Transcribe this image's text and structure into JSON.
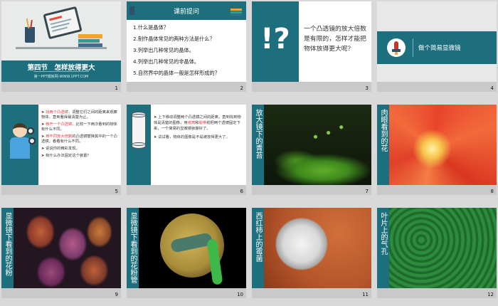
{
  "slides": [
    {
      "num": "1",
      "title": "第四节　怎样放得更大",
      "footer_text": "第一PPT模板网-WWW.1PPT.COM"
    },
    {
      "num": "2",
      "title": "课前提问",
      "items": [
        "1.什么是晶体？",
        "2.制作晶体常见的两种方法是什么？",
        "3.列举出几种常见的晶体。",
        "4.列举出几种常见的非晶体。",
        "5.自然界中的晶体一般是怎样形成的？"
      ]
    },
    {
      "num": "3",
      "symbol": "!?",
      "question": "一个凸透镜的放大倍数是有限的，怎样才能把物体放得更大呢？"
    },
    {
      "num": "4",
      "title": "做个简易显微镜"
    },
    {
      "num": "5",
      "bullets": [
        {
          "highlight": "找两个凸透镜，",
          "text": "调整它们之间的距离来观察物体，直到看得最清楚为止。"
        },
        {
          "highlight": "移开一个凸透镜，",
          "text": "比较一下两次看到的物体有什么不同。"
        },
        {
          "highlight": "用不同放大倍数",
          "text": "的凸透镜替换其中的一个凸透镜，看看有什么不同。"
        },
        {
          "highlight": "",
          "text": "说说你的精彩发现。"
        },
        {
          "highlight": "",
          "text": "有什么办法固定这个装置？"
        }
      ]
    },
    {
      "num": "6",
      "para1": [
        "上下移动调整两个凸透镜之间的距离，直到找到物体是清楚的图像，用",
        "纸筒",
        "和",
        "胶带",
        "纸把两个透镜固定下来，一个简易的显微镜就做好了。"
      ],
      "para2": "试试看，物体的图像是不是被放得更大了。"
    },
    {
      "num": "7",
      "label": "放大镜下的青苔"
    },
    {
      "num": "8",
      "label": "肉眼看到的花"
    },
    {
      "num": "9",
      "label": "显微镜下看到的花粉"
    },
    {
      "num": "10",
      "label": "显微镜下看到的花粉管"
    },
    {
      "num": "11",
      "label": "西红柿上的霉菌"
    },
    {
      "num": "12",
      "label": "叶片上的气孔"
    }
  ],
  "colors": {
    "teal": "#1d6f7d",
    "red": "#e0393e",
    "background": "#d9d9d9"
  },
  "icons": [
    "pencil-cup-icon",
    "laptop-icon",
    "books-icon",
    "rocket-icon",
    "boy-with-lens-icon",
    "microscope-tube-icon"
  ]
}
